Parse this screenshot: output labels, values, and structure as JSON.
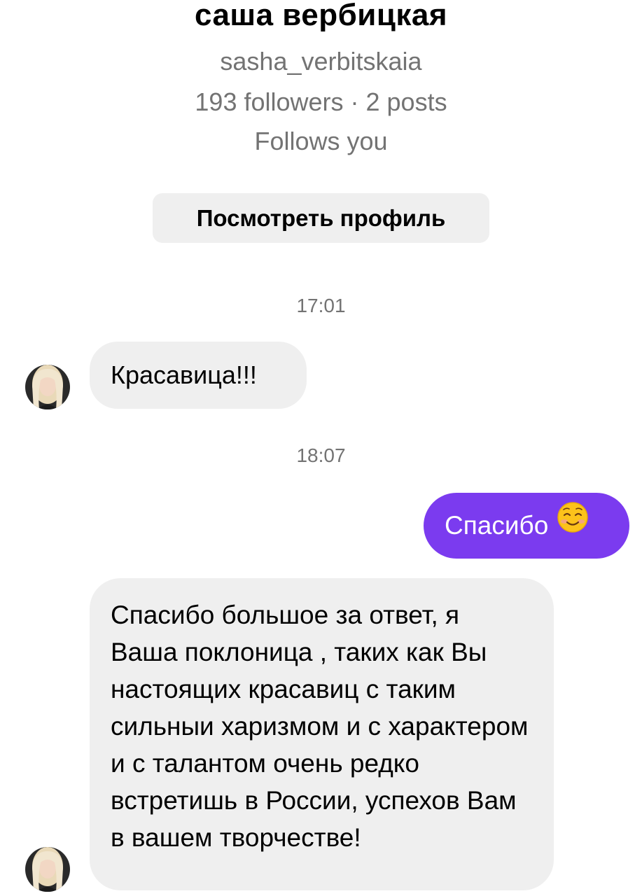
{
  "profile": {
    "name": "саша вербицкая",
    "username": "sasha_verbitskaia",
    "stats": "193 followers · 2 posts",
    "follows_status": "Follows you",
    "view_profile_label": "Посмотреть профиль"
  },
  "conversation": {
    "timestamps": [
      "17:01",
      "18:07"
    ],
    "messages": [
      {
        "direction": "incoming",
        "text": "Красавица!!!"
      },
      {
        "direction": "outgoing",
        "text": "Спасибо",
        "emoji": "smiling-face-icon"
      },
      {
        "direction": "incoming",
        "text": "Спасибо большое за ответ, я Ваша поклоница , таких как Вы настоящих красавиц с таким сильныи харизмом и с характером и с талантом очень редко встретишь в России, успехов Вам в вашем творчестве!"
      }
    ]
  },
  "colors": {
    "outgoing_bubble": "#7b3bef",
    "incoming_bubble": "#efefef",
    "secondary_text": "#737373",
    "button_background": "#efefef"
  }
}
